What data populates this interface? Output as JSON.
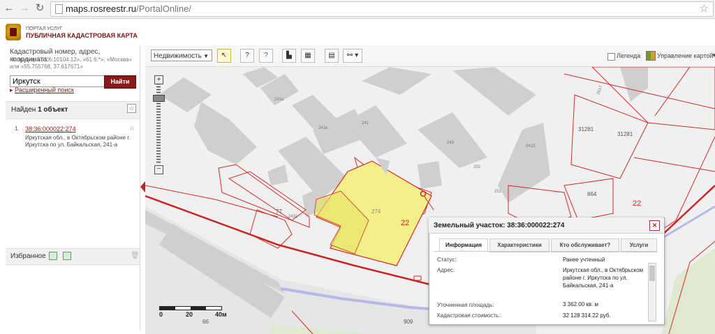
{
  "browser": {
    "url_host": "maps.rosreestr.ru",
    "url_path": "/PortalOnline/"
  },
  "header": {
    "portal_small": "ПОРТАЛ УСЛУГ",
    "portal_title": "ПУБЛИЧНАЯ КАДАСТРОВАЯ КАРТА"
  },
  "search": {
    "hint": "Кадастровый номер, адрес, координата:",
    "examples": "Например «61:6:10104:12», «61:6:*», «Москва» или «55.755768, 37.617671»",
    "value": "Иркутск",
    "button": "Найти",
    "advanced": "Расширенный поиск"
  },
  "results": {
    "found_prefix": "Найден",
    "found_count": "1 объект",
    "items": [
      {
        "num": "1.",
        "cadastral": "38:36:000022:274",
        "address": "Иркутская обл., в Октябрьском районе г. Иркутска по ул. Байкальская, 241-а"
      }
    ]
  },
  "favorites": {
    "label": "Избранное"
  },
  "toolbar": {
    "layer_select": "Недвижимость",
    "legend": "Легенда",
    "map_control": "Управление картой"
  },
  "map": {
    "labels": {
      "l241a": "241а",
      "l241v": "241в",
      "l241": "241",
      "l243": "243",
      "l252": "252",
      "l241b": "241б",
      "l251": "251",
      "l274": "274",
      "l22a": "22",
      "l22b": "22",
      "l77": "77",
      "l31281a": "31281",
      "l31281b": "31281",
      "l864": "864",
      "l2617": "2617",
      "l909": "909",
      "l66": "66",
      "l243a": "243а"
    },
    "scale": [
      "0",
      "20",
      "40м"
    ]
  },
  "popup": {
    "title": "Земельный участок: 38:36:000022:274",
    "tabs": [
      "Информация",
      "Характеристики",
      "Кто обслуживает?",
      "Услуги"
    ],
    "rows": [
      {
        "label": "Статус:",
        "value": "Ранее учтенный"
      },
      {
        "label": "Адрес:",
        "value": "Иркутская обл., в Октябрьском районе г. Иркутска по ул. Байкальская, 241-а"
      },
      {
        "label": "Уточненная площадь:",
        "value": "3 362.00 кв. м"
      },
      {
        "label": "Кадастровая стоимость:",
        "value": "32 128 314.22 руб."
      }
    ]
  },
  "colors": {
    "accent": "#8a1a1a",
    "parcel_fill": "#f3f08a",
    "boundary": "#d42a2a"
  }
}
